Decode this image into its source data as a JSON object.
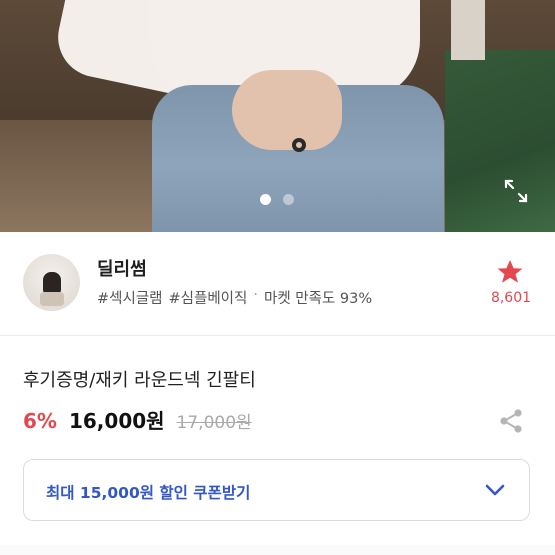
{
  "gallery": {
    "slides": 2,
    "active_slide": 1
  },
  "icons": {
    "expand": "expand-icon",
    "favorite": "star-icon",
    "share": "share-icon",
    "dropdown": "chevron-down-icon"
  },
  "seller": {
    "name": "딜리썸",
    "tags": [
      "#섹시글램",
      "#심플베이직"
    ],
    "separator": "·",
    "satisfaction": "마켓 만족도 93%",
    "favorite_count": "8,601"
  },
  "product": {
    "title": "후기증명/재키 라운드넥 긴팔티",
    "discount": "6%",
    "price": "16,000원",
    "original_price": "17,000원"
  },
  "coupon": {
    "label": "최대 15,000원 할인 쿠폰받기"
  },
  "colors": {
    "accent_red": "#e5474f",
    "coupon_blue": "#3357c7",
    "border": "#d8dce4"
  }
}
